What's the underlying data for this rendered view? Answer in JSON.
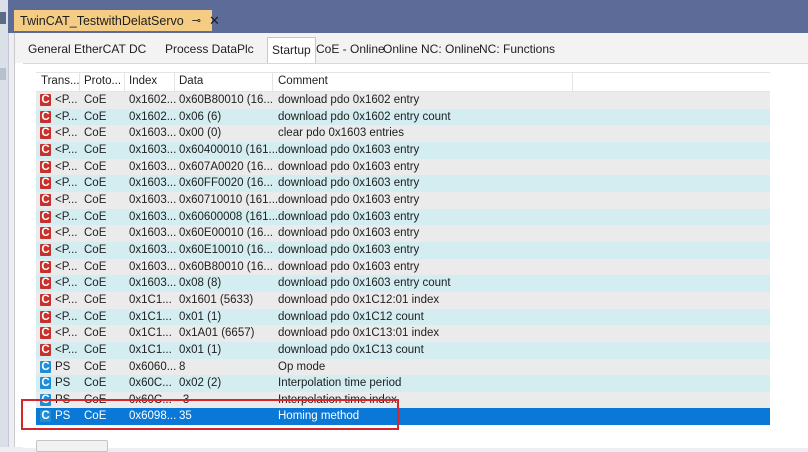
{
  "document_tab": {
    "title": "TwinCAT_TestwithDelatServo",
    "pin": "⊸",
    "close": "✕"
  },
  "tabs": [
    {
      "label": "General"
    },
    {
      "label": "EtherCAT"
    },
    {
      "label": "DC"
    },
    {
      "label": "Process Data"
    },
    {
      "label": "Plc"
    },
    {
      "label": "Startup"
    },
    {
      "label": "CoE - Online"
    },
    {
      "label": "Online"
    },
    {
      "label": "NC: Online"
    },
    {
      "label": "NC: Functions"
    }
  ],
  "active_tab": "Startup",
  "table": {
    "columns": [
      "Trans...",
      "Proto...",
      "Index",
      "Data",
      "Comment"
    ],
    "rows": [
      {
        "icon": "C",
        "icon_color": "red",
        "trans": "<P...",
        "proto": "CoE",
        "index": "0x1602...",
        "data": "0x60B80010 (16...",
        "comment": "download pdo 0x1602 entry"
      },
      {
        "icon": "C",
        "icon_color": "red",
        "trans": "<P...",
        "proto": "CoE",
        "index": "0x1602...",
        "data": "0x06 (6)",
        "comment": "download pdo 0x1602 entry count"
      },
      {
        "icon": "C",
        "icon_color": "red",
        "trans": "<P...",
        "proto": "CoE",
        "index": "0x1603...",
        "data": "0x00 (0)",
        "comment": "clear pdo 0x1603 entries"
      },
      {
        "icon": "C",
        "icon_color": "red",
        "trans": "<P...",
        "proto": "CoE",
        "index": "0x1603...",
        "data": "0x60400010 (161...",
        "comment": "download pdo 0x1603 entry"
      },
      {
        "icon": "C",
        "icon_color": "red",
        "trans": "<P...",
        "proto": "CoE",
        "index": "0x1603...",
        "data": "0x607A0020 (16...",
        "comment": "download pdo 0x1603 entry"
      },
      {
        "icon": "C",
        "icon_color": "red",
        "trans": "<P...",
        "proto": "CoE",
        "index": "0x1603...",
        "data": "0x60FF0020 (16...",
        "comment": "download pdo 0x1603 entry"
      },
      {
        "icon": "C",
        "icon_color": "red",
        "trans": "<P...",
        "proto": "CoE",
        "index": "0x1603...",
        "data": "0x60710010 (161...",
        "comment": "download pdo 0x1603 entry"
      },
      {
        "icon": "C",
        "icon_color": "red",
        "trans": "<P...",
        "proto": "CoE",
        "index": "0x1603...",
        "data": "0x60600008 (161...",
        "comment": "download pdo 0x1603 entry"
      },
      {
        "icon": "C",
        "icon_color": "red",
        "trans": "<P...",
        "proto": "CoE",
        "index": "0x1603...",
        "data": "0x60E00010 (16...",
        "comment": "download pdo 0x1603 entry"
      },
      {
        "icon": "C",
        "icon_color": "red",
        "trans": "<P...",
        "proto": "CoE",
        "index": "0x1603...",
        "data": "0x60E10010 (16...",
        "comment": "download pdo 0x1603 entry"
      },
      {
        "icon": "C",
        "icon_color": "red",
        "trans": "<P...",
        "proto": "CoE",
        "index": "0x1603...",
        "data": "0x60B80010 (16...",
        "comment": "download pdo 0x1603 entry"
      },
      {
        "icon": "C",
        "icon_color": "red",
        "trans": "<P...",
        "proto": "CoE",
        "index": "0x1603...",
        "data": "0x08 (8)",
        "comment": "download pdo 0x1603 entry count"
      },
      {
        "icon": "C",
        "icon_color": "red",
        "trans": "<P...",
        "proto": "CoE",
        "index": "0x1C1...",
        "data": "0x1601 (5633)",
        "comment": "download pdo 0x1C12:01 index"
      },
      {
        "icon": "C",
        "icon_color": "red",
        "trans": "<P...",
        "proto": "CoE",
        "index": "0x1C1...",
        "data": "0x01 (1)",
        "comment": "download pdo 0x1C12 count"
      },
      {
        "icon": "C",
        "icon_color": "red",
        "trans": "<P...",
        "proto": "CoE",
        "index": "0x1C1...",
        "data": "0x1A01 (6657)",
        "comment": "download pdo 0x1C13:01 index"
      },
      {
        "icon": "C",
        "icon_color": "red",
        "trans": "<P...",
        "proto": "CoE",
        "index": "0x1C1...",
        "data": "0x01 (1)",
        "comment": "download pdo 0x1C13 count"
      },
      {
        "icon": "C",
        "icon_color": "blue",
        "trans": "PS",
        "proto": "CoE",
        "index": "0x6060...",
        "data": "8",
        "comment": "Op mode"
      },
      {
        "icon": "C",
        "icon_color": "blue",
        "trans": "PS",
        "proto": "CoE",
        "index": "0x60C...",
        "data": "0x02 (2)",
        "comment": "Interpolation time period"
      },
      {
        "icon": "C",
        "icon_color": "blue",
        "trans": "PS",
        "proto": "CoE",
        "index": "0x60C...",
        "data": "-3",
        "comment": "Interpolation time index"
      },
      {
        "icon": "C",
        "icon_color": "blue",
        "trans": "PS",
        "proto": "CoE",
        "index": "0x6098...",
        "data": "35",
        "comment": "Homing method",
        "selected": true
      }
    ]
  }
}
